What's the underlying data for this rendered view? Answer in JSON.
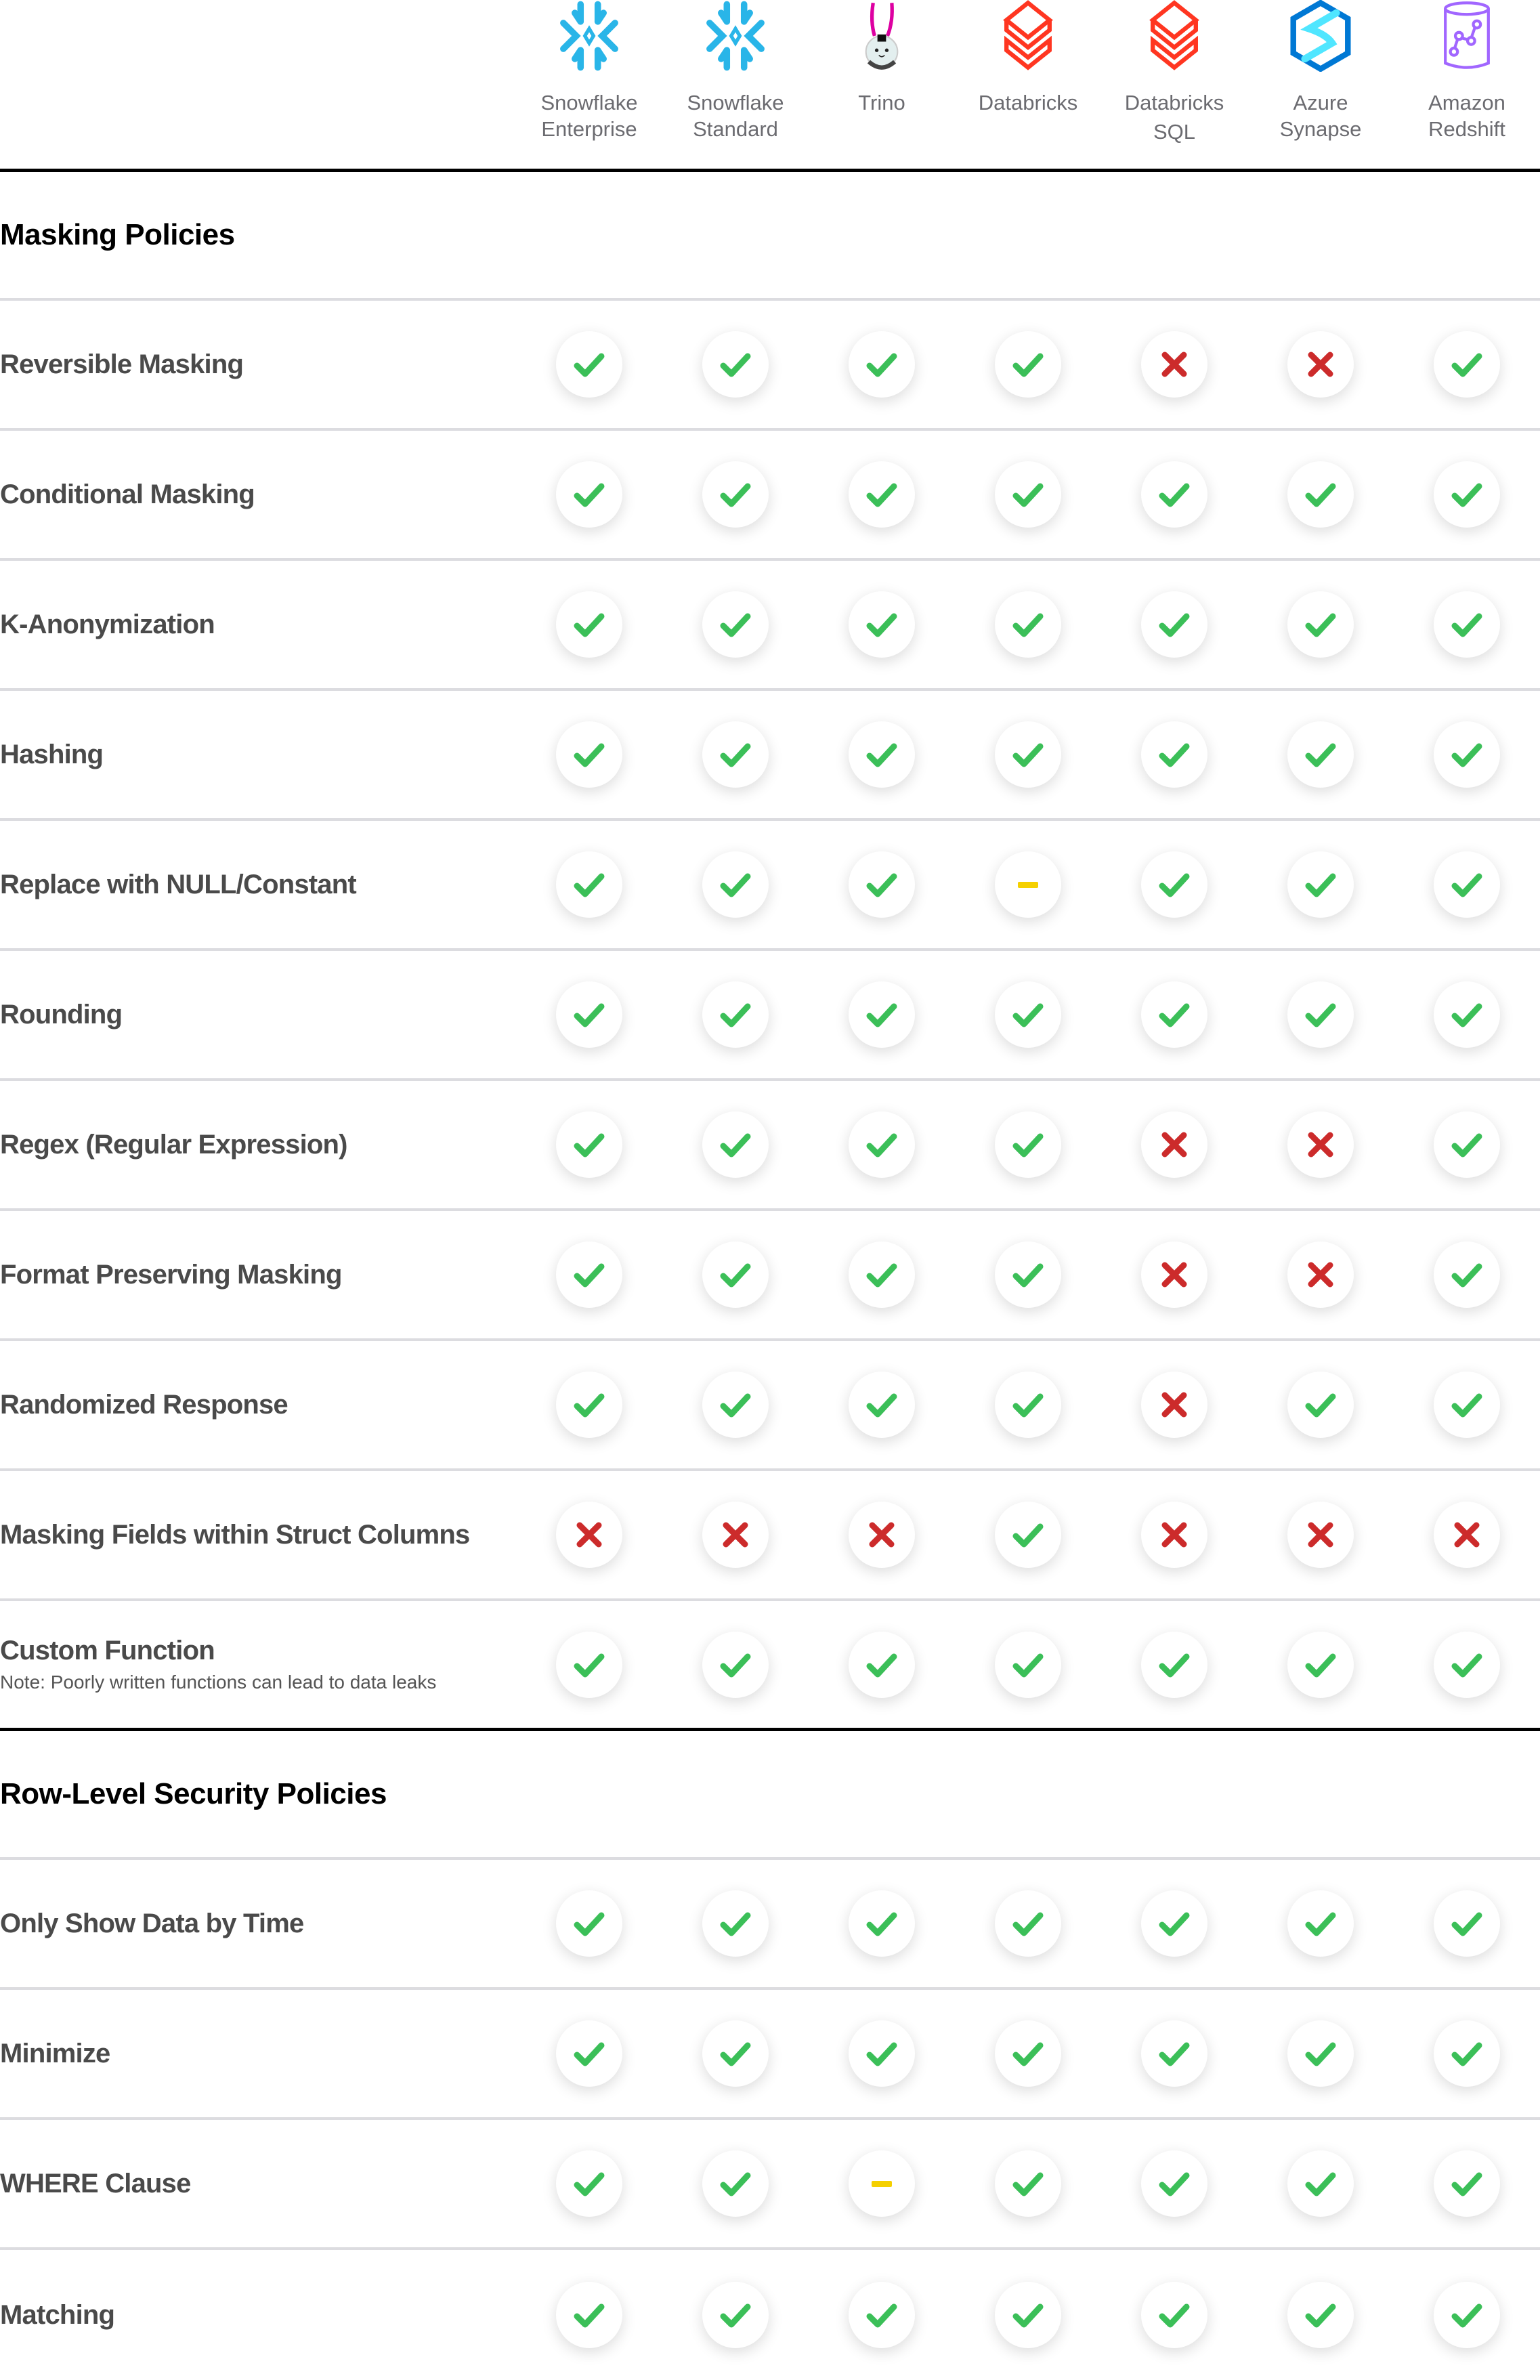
{
  "colors": {
    "yes": "#3bbf58",
    "no": "#cc2b2b",
    "partial": "#f5d000",
    "snowflake": "#29b5e8",
    "databricks": "#ff3621",
    "azure_dark": "#0078d4",
    "azure_light": "#50e6ff",
    "redshift": "#a166ff",
    "trino_ear": "#dd00a1"
  },
  "vendors": [
    {
      "name_line1": "Snowflake",
      "name_line2": "Enterprise",
      "icon": "snowflake-icon"
    },
    {
      "name_line1": "Snowflake",
      "name_line2": "Standard",
      "icon": "snowflake-icon"
    },
    {
      "name_line1": "Trino",
      "name_line2": "",
      "icon": "trino-bunny-icon"
    },
    {
      "name_line1": "Databricks",
      "name_line2": "",
      "icon": "databricks-icon"
    },
    {
      "name_line1": "Databricks",
      "name_line2": "SQL",
      "icon": "databricks-icon"
    },
    {
      "name_line1": "Azure",
      "name_line2": "Synapse",
      "icon": "azure-synapse-icon"
    },
    {
      "name_line1": "Amazon",
      "name_line2": "Redshift",
      "icon": "redshift-icon"
    }
  ],
  "sections": [
    {
      "title": "Masking Policies",
      "rows": [
        {
          "label": "Reversible Masking",
          "note": "",
          "values": [
            "yes",
            "yes",
            "yes",
            "yes",
            "no",
            "no",
            "yes"
          ]
        },
        {
          "label": "Conditional Masking",
          "note": "",
          "values": [
            "yes",
            "yes",
            "yes",
            "yes",
            "yes",
            "yes",
            "yes"
          ]
        },
        {
          "label": "K-Anonymization",
          "note": "",
          "values": [
            "yes",
            "yes",
            "yes",
            "yes",
            "yes",
            "yes",
            "yes"
          ]
        },
        {
          "label": "Hashing",
          "note": "",
          "values": [
            "yes",
            "yes",
            "yes",
            "yes",
            "yes",
            "yes",
            "yes"
          ]
        },
        {
          "label": "Replace with NULL/Constant",
          "note": "",
          "values": [
            "yes",
            "yes",
            "yes",
            "partial",
            "yes",
            "yes",
            "yes"
          ]
        },
        {
          "label": "Rounding",
          "note": "",
          "values": [
            "yes",
            "yes",
            "yes",
            "yes",
            "yes",
            "yes",
            "yes"
          ]
        },
        {
          "label": "Regex (Regular Expression)",
          "note": "",
          "values": [
            "yes",
            "yes",
            "yes",
            "yes",
            "no",
            "no",
            "yes"
          ]
        },
        {
          "label": "Format Preserving Masking",
          "note": "",
          "values": [
            "yes",
            "yes",
            "yes",
            "yes",
            "no",
            "no",
            "yes"
          ]
        },
        {
          "label": "Randomized Response",
          "note": "",
          "values": [
            "yes",
            "yes",
            "yes",
            "yes",
            "no",
            "yes",
            "yes"
          ]
        },
        {
          "label": "Masking Fields within Struct Columns",
          "note": "",
          "values": [
            "no",
            "no",
            "no",
            "yes",
            "no",
            "no",
            "no"
          ]
        },
        {
          "label": "Custom Function",
          "note": "Note: Poorly written functions can lead to data leaks",
          "values": [
            "yes",
            "yes",
            "yes",
            "yes",
            "yes",
            "yes",
            "yes"
          ]
        }
      ]
    },
    {
      "title": "Row-Level Security Policies",
      "rows": [
        {
          "label": "Only Show Data by Time",
          "note": "",
          "values": [
            "yes",
            "yes",
            "yes",
            "yes",
            "yes",
            "yes",
            "yes"
          ]
        },
        {
          "label": "Minimize",
          "note": "",
          "values": [
            "yes",
            "yes",
            "yes",
            "yes",
            "yes",
            "yes",
            "yes"
          ]
        },
        {
          "label": "WHERE Clause",
          "note": "",
          "values": [
            "yes",
            "yes",
            "partial",
            "yes",
            "yes",
            "yes",
            "yes"
          ]
        },
        {
          "label": "Matching",
          "note": "",
          "values": [
            "yes",
            "yes",
            "yes",
            "yes",
            "yes",
            "yes",
            "yes"
          ]
        }
      ]
    }
  ]
}
